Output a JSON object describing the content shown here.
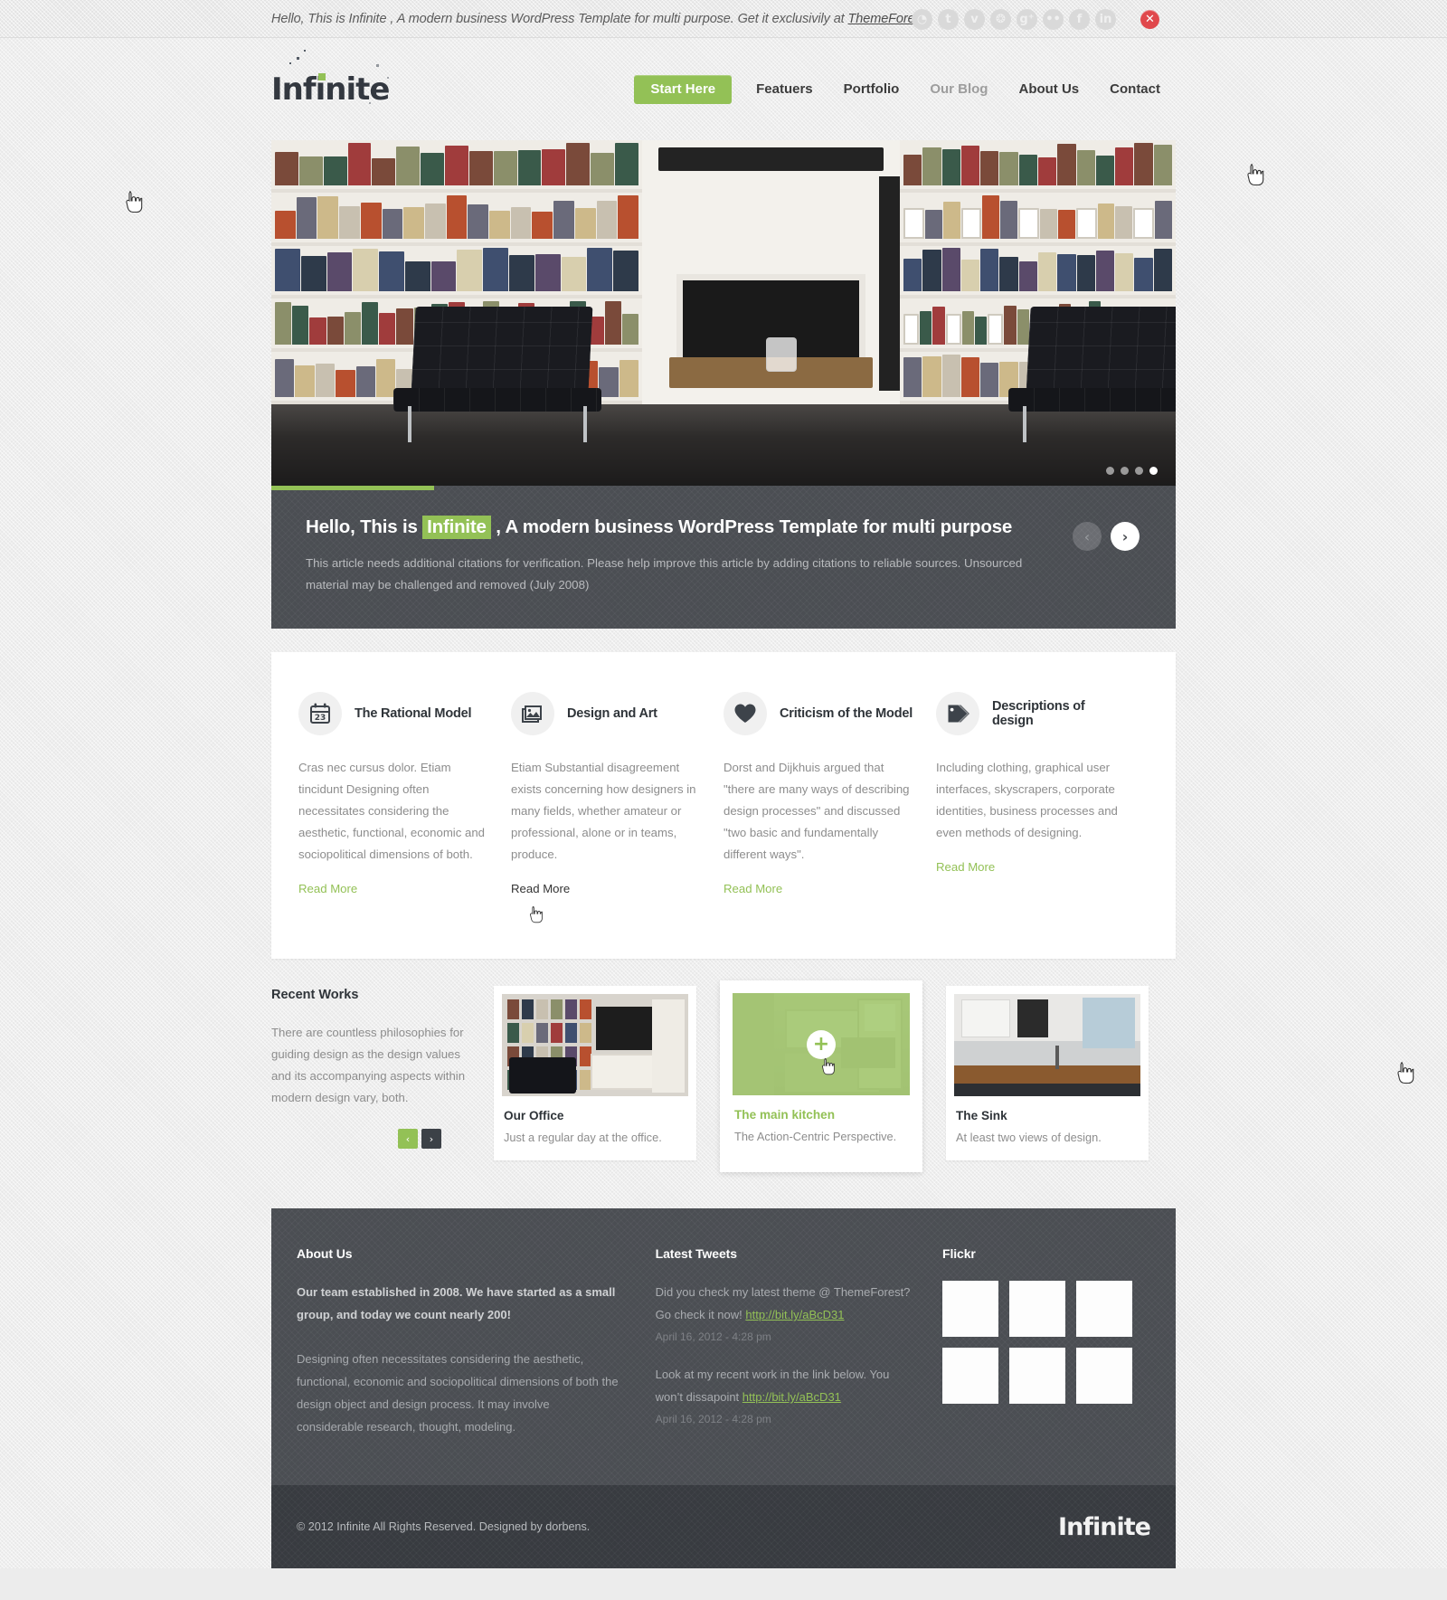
{
  "topbar": {
    "message_pre": "Hello, This is Infinite , A modern business WordPress Template for multi purpose. Get it exclusivily at ",
    "message_link": "ThemeForest",
    "social": [
      {
        "name": "rss-icon",
        "glyph": "◔",
        "label": "RSS"
      },
      {
        "name": "twitter-icon",
        "glyph": "t",
        "label": "Twitter"
      },
      {
        "name": "vimeo-icon",
        "glyph": "v",
        "label": "Vimeo"
      },
      {
        "name": "dribbble-icon",
        "glyph": "❂",
        "label": "Dribbble"
      },
      {
        "name": "google-plus-icon",
        "glyph": "g⁺",
        "label": "Google Plus"
      },
      {
        "name": "flickr-icon",
        "glyph": "••",
        "label": "Flickr"
      },
      {
        "name": "facebook-icon",
        "glyph": "f",
        "label": "Facebook"
      },
      {
        "name": "linkedin-icon",
        "glyph": "in",
        "label": "LinkedIn"
      }
    ],
    "close_label": "✕"
  },
  "header": {
    "logo": "Infinite",
    "nav": [
      {
        "label": "Start Here",
        "state": "active"
      },
      {
        "label": "Featuers",
        "state": "default"
      },
      {
        "label": "Portfolio",
        "state": "default"
      },
      {
        "label": "Our Blog",
        "state": "hovered"
      },
      {
        "label": "About Us",
        "state": "default"
      },
      {
        "label": "Contact",
        "state": "default"
      }
    ]
  },
  "slider": {
    "title_pre": "Hello, This is ",
    "title_highlight": "Infinite",
    "title_post": " , A modern business WordPress Template for multi purpose",
    "body": "This article needs additional citations for verification. Please help improve this article by adding citations to reliable sources. Unsourced material may be challenged and removed (July 2008)",
    "prev_glyph": "‹",
    "next_glyph": "›",
    "dots": 4,
    "active_dot": 4,
    "progress_percent": 18
  },
  "features": [
    {
      "icon": "calendar-icon",
      "icon_value": "23",
      "title": "The Rational Model",
      "body": "Cras nec cursus dolor. Etiam tincidunt Designing often necessitates considering the aesthetic, functional, economic and sociopolitical dimensions of both.",
      "read_more": "Read More",
      "read_more_state": "default"
    },
    {
      "icon": "image-icon",
      "icon_value": "",
      "title": "Design and Art",
      "body": "Etiam Substantial disagreement exists concerning how designers in many fields, whether amateur or professional, alone or in teams, produce.",
      "read_more": "Read More",
      "read_more_state": "hovered"
    },
    {
      "icon": "heart-icon",
      "icon_value": "",
      "title": "Criticism of the Model",
      "body": "Dorst and Dijkhuis argued that \"there are many ways of describing design processes\" and discussed \"two basic and fundamentally different ways\".",
      "read_more": "Read More",
      "read_more_state": "default"
    },
    {
      "icon": "tag-icon",
      "icon_value": "",
      "title": "Descriptions of design",
      "body": "Including clothing, graphical user interfaces, skyscrapers, corporate identities, business processes and even methods of designing.",
      "read_more": "Read More",
      "read_more_state": "default"
    }
  ],
  "works": {
    "title": "Recent Works",
    "text": "There are countless philosophies for guiding design as the design values and its accompanying aspects within modern design vary, both.",
    "prev_glyph": "‹",
    "next_glyph": "›",
    "items": [
      {
        "name": "Our Office",
        "desc": "Just a regular day at the office.",
        "state": "default",
        "thumb": "office"
      },
      {
        "name": "The main kitchen",
        "desc": "The Action-Centric Perspective.",
        "state": "hovered",
        "thumb": "kitchen",
        "overlay_glyph": "+"
      },
      {
        "name": "The Sink",
        "desc": "At least two views of design.",
        "state": "default",
        "thumb": "sink"
      }
    ]
  },
  "footer": {
    "about": {
      "heading": "About Us",
      "lead": "Our team established in 2008. We have started as a small group, and today we count nearly 200!",
      "body": "Designing often necessitates considering the aesthetic, functional, economic and sociopolitical dimensions of both the design object and design process. It may involve considerable research, thought, modeling."
    },
    "tweets": {
      "heading": "Latest Tweets",
      "items": [
        {
          "text_pre": "Did you check my latest theme @ ThemeForest? Go check it now! ",
          "link": "http://bit.ly/aBcD31",
          "text_post": "",
          "date": "April 16, 2012 - 4:28 pm"
        },
        {
          "text_pre": "Look at my recent work in the link below. You won’t dissapoint ",
          "link": "http://bit.ly/aBcD31",
          "text_post": "",
          "date": "April 16, 2012 - 4:28 pm"
        }
      ]
    },
    "flickr": {
      "heading": "Flickr",
      "cell_count": 6
    }
  },
  "copyright": {
    "text": "© 2012 Infinite All Rights Reserved. Designed by dorbens.",
    "logo": "Infinite"
  },
  "colors": {
    "accent_green": "#93c156",
    "dark_panel": "#4b4e53",
    "darker_bar": "#383b40",
    "close_red": "#e0484c"
  }
}
